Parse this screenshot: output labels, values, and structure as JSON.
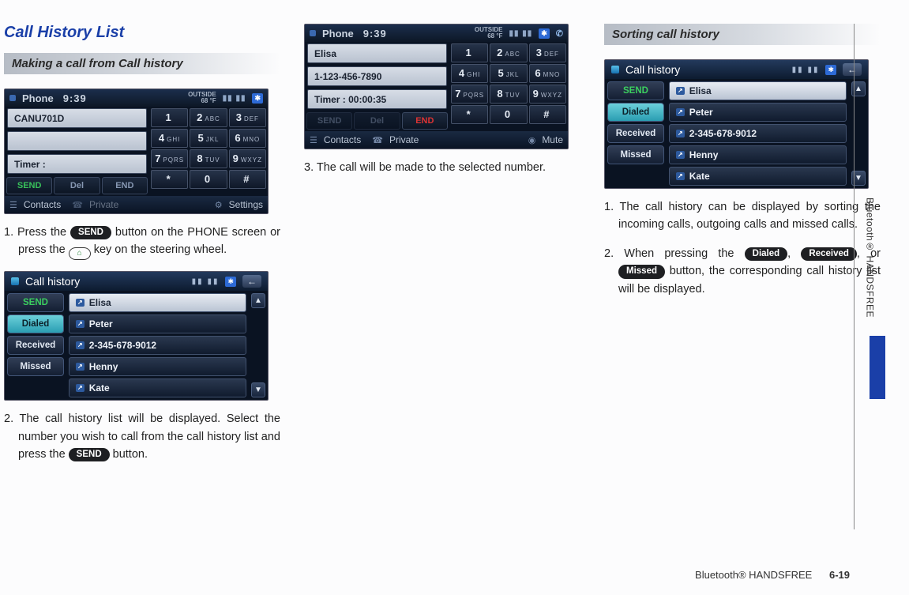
{
  "title": "Call History List",
  "section1": {
    "heading": "Making a call from Call history",
    "phone1": {
      "appname": "Phone",
      "time": "9:39",
      "temp_top": "OUTSIDE",
      "temp": "68 °F",
      "input": "CANU701D",
      "blank1": "",
      "timer": "Timer :",
      "keys": [
        {
          "n": "1",
          "l": ""
        },
        {
          "n": "2",
          "l": "ABC"
        },
        {
          "n": "3",
          "l": "DEF"
        },
        {
          "n": "4",
          "l": "GHI"
        },
        {
          "n": "5",
          "l": "JKL"
        },
        {
          "n": "6",
          "l": "MNO"
        },
        {
          "n": "7",
          "l": "PQRS"
        },
        {
          "n": "8",
          "l": "TUV"
        },
        {
          "n": "9",
          "l": "WXYZ"
        },
        {
          "n": "*",
          "l": ""
        },
        {
          "n": "0",
          "l": ""
        },
        {
          "n": "#",
          "l": ""
        }
      ],
      "ctrl": {
        "send": "SEND",
        "del": "Del",
        "end": "END"
      },
      "bottom": {
        "a": "Contacts",
        "b": "Private",
        "c": "Settings"
      }
    },
    "step1_a": "1. Press the ",
    "step1_b": " button on the PHONE screen or press the ",
    "step1_c": " key on the steering wheel.",
    "send_label": "SEND",
    "callhist": {
      "title": "Call history",
      "tabs": {
        "send": "SEND",
        "dialed": "Dialed",
        "received": "Received",
        "missed": "Missed"
      },
      "items": [
        "Elisa",
        "Peter",
        "2-345-678-9012",
        "Henny",
        "Kate"
      ]
    },
    "step2_a": "2. The call history list will be displayed. Select the number you wish to call from the call history list and press the ",
    "step2_b": " button."
  },
  "section2": {
    "phone2": {
      "appname": "Phone",
      "time": "9:39",
      "temp_top": "OUTSIDE",
      "temp": "68 °F",
      "input": "Elisa",
      "number": "1-123-456-7890",
      "timer": "Timer : 00:00:35",
      "keys": [
        {
          "n": "1",
          "l": ""
        },
        {
          "n": "2",
          "l": "ABC"
        },
        {
          "n": "3",
          "l": "DEF"
        },
        {
          "n": "4",
          "l": "GHI"
        },
        {
          "n": "5",
          "l": "JKL"
        },
        {
          "n": "6",
          "l": "MNO"
        },
        {
          "n": "7",
          "l": "PQRS"
        },
        {
          "n": "8",
          "l": "TUV"
        },
        {
          "n": "9",
          "l": "WXYZ"
        },
        {
          "n": "*",
          "l": ""
        },
        {
          "n": "0",
          "l": ""
        },
        {
          "n": "#",
          "l": ""
        }
      ],
      "ctrl": {
        "send": "SEND",
        "del": "Del",
        "end": "END"
      },
      "bottom": {
        "a": "Contacts",
        "b": "Private",
        "c": "Mute"
      }
    },
    "step3": "3. The call will be made to the selected num­ber."
  },
  "section3": {
    "heading": "Sorting call history",
    "callhist": {
      "title": "Call history",
      "tabs": {
        "send": "SEND",
        "dialed": "Dialed",
        "received": "Received",
        "missed": "Missed"
      },
      "items": [
        "Elisa",
        "Peter",
        "2-345-678-9012",
        "Henny",
        "Kate"
      ]
    },
    "step1": "1. The call history can be displayed by sorting the incoming calls, outgoing calls and mis­sed calls.",
    "step2_a": "2. When pressing the ",
    "step2_b": ", ",
    "step2_c": ", or ",
    "step2_d": " button, the corresponding call his­tory list will be displayed.",
    "pill_dialed": "Dialed",
    "pill_received": "Received",
    "pill_missed": "Missed"
  },
  "sidetab": "Bluetooth® HANDSFREE",
  "footer": {
    "section": "Bluetooth® HANDSFREE",
    "page": "6-19"
  }
}
